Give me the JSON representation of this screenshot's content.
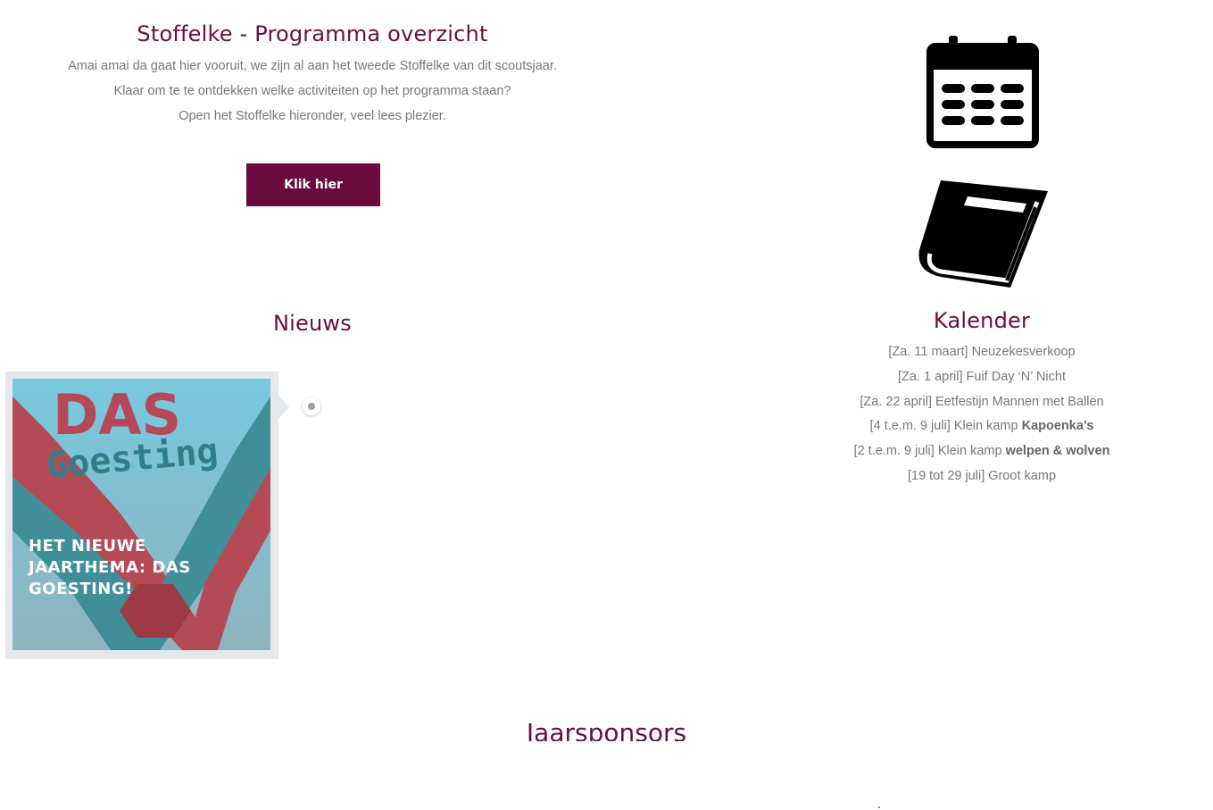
{
  "program": {
    "title": "Stoffelke - Programma overzicht",
    "intro": [
      "Amai amai da gaat hier vooruit, we zijn al aan het tweede Stoffelke van dit scoutsjaar.",
      "Klaar om te te ontdekken welke activiteiten op het programma staan?",
      "Open het Stoffelke hieronder, veel lees plezier."
    ],
    "button_label": "Klik hier"
  },
  "icons": {
    "calendar": "calendar-icon",
    "book": "book-icon"
  },
  "news": {
    "title": "Nieuws",
    "item": {
      "image_text_line1": "DAS",
      "image_text_line2": "Goesting",
      "headline": "HET NIEUWE JAARTHEMA: DAS GOESTING!"
    }
  },
  "calendar": {
    "title": "Kalender",
    "items": [
      {
        "text": "[Za. 11 maart] Neuzekesverkoop",
        "bold": ""
      },
      {
        "text": "[Za. 1 april] Fuif Day ‘N’ Nicht",
        "bold": ""
      },
      {
        "text": "[Za. 22 april] Eetfestijn Mannen met Ballen",
        "bold": ""
      },
      {
        "text": "[4 t.e.m. 9 juli] Klein kamp ",
        "bold": "Kapoenka’s"
      },
      {
        "text": "[2 t.e.m. 9 juli] Klein kamp ",
        "bold": "welpen & wolven"
      },
      {
        "text": "[19 tot 29 juli] Groot kamp",
        "bold": ""
      }
    ]
  },
  "sponsors": {
    "title": "Jaarsponsors"
  },
  "colors": {
    "accent": "#6b0d3c",
    "button": "#6b0a3d",
    "text": "#777777",
    "card_bg": "#e4e8eb"
  }
}
